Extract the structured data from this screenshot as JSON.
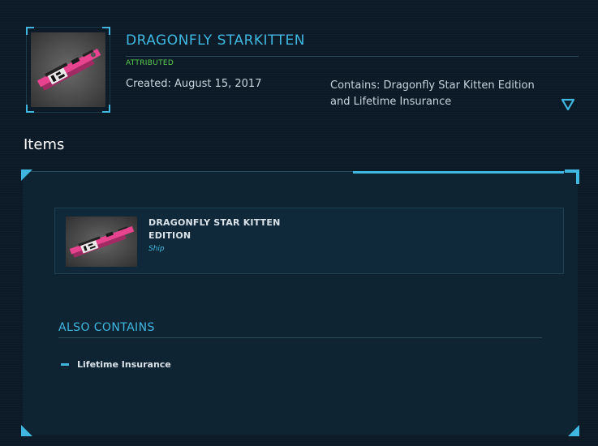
{
  "pledge": {
    "title": "DRAGONFLY STARKITTEN",
    "status": "ATTRIBUTED",
    "created": "Created: August 15, 2017",
    "contains": "Contains: Dragonfly Star Kitten Edition and Lifetime Insurance",
    "expand_icon": "chevron-down-icon"
  },
  "items_section": {
    "title": "Items",
    "items": [
      {
        "name": "DRAGONFLY STAR KITTEN EDITION",
        "type": "Ship"
      }
    ],
    "also_contains": {
      "title": "ALSO CONTAINS",
      "entries": [
        "Lifetime Insurance"
      ]
    }
  },
  "colors": {
    "accent": "#3fb7e0",
    "status_green": "#5ad04f",
    "background": "#0b1a26",
    "panel": "#0f2433"
  }
}
